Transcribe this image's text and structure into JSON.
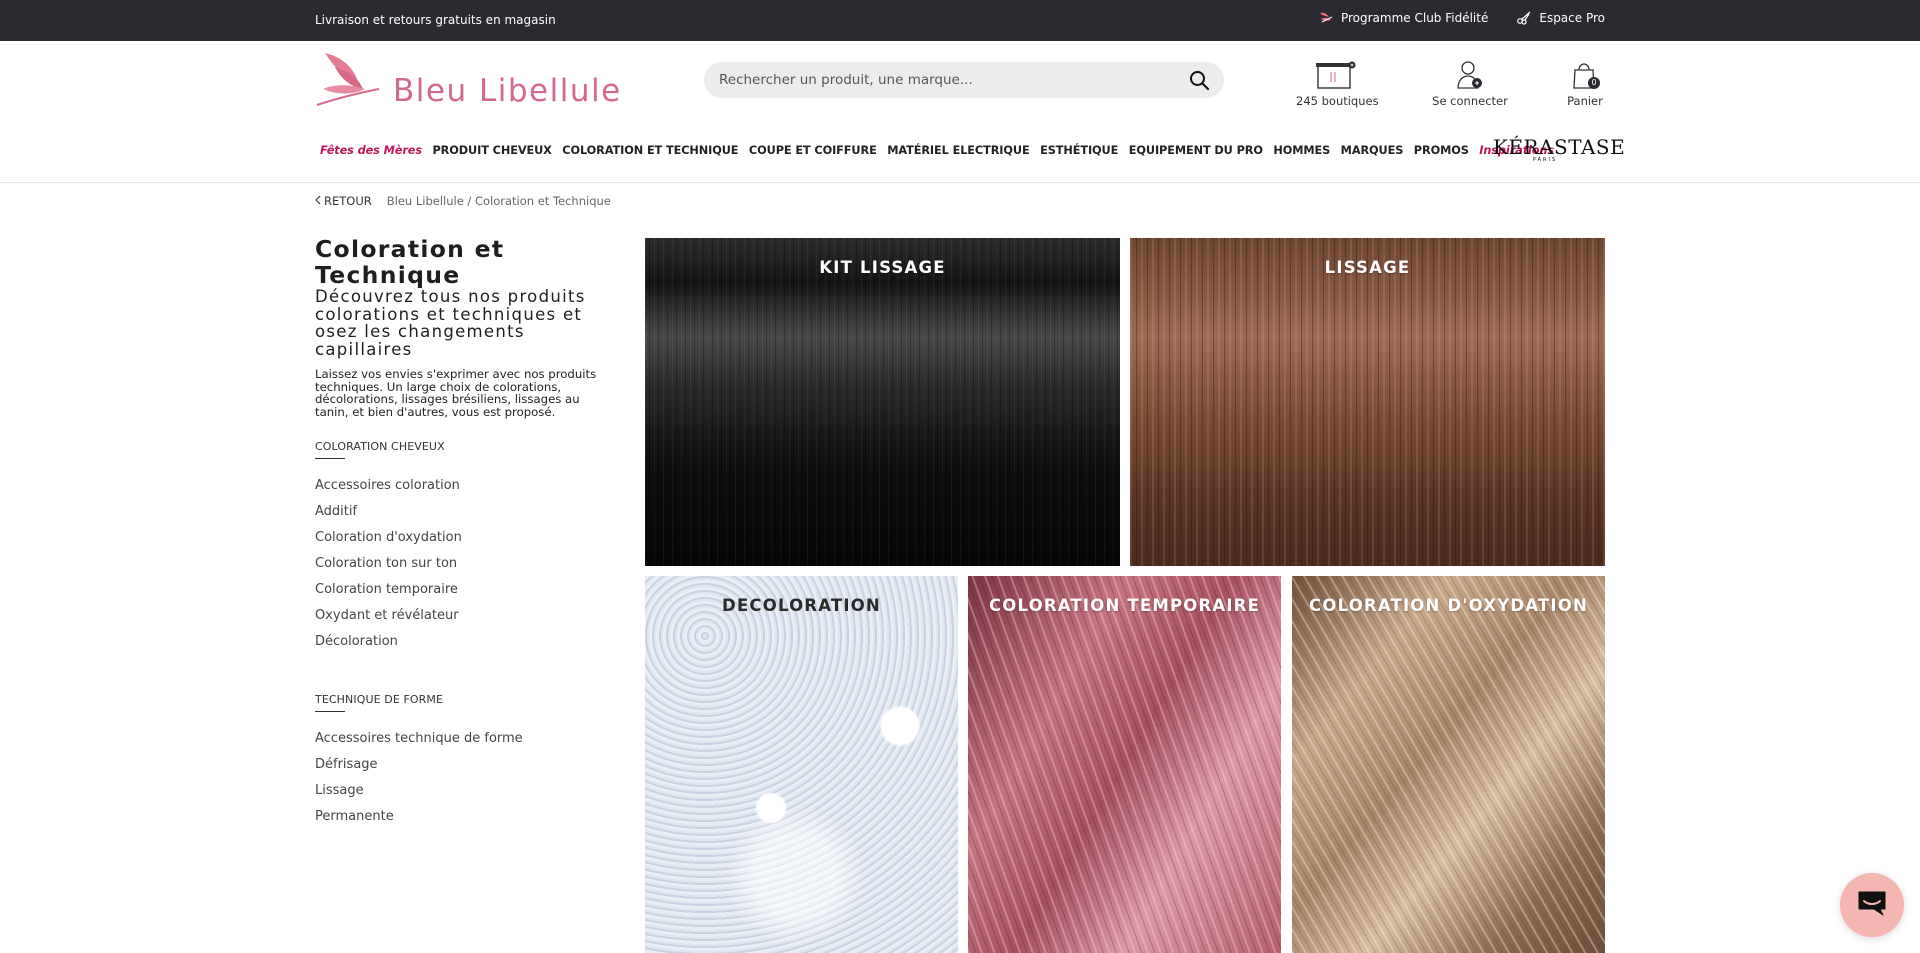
{
  "topbar": {
    "promo": "Livraison et retours gratuits en magasin",
    "club": "Programme Club Fidélité",
    "pro": "Espace Pro"
  },
  "header": {
    "brand": "Bleu Libellule",
    "search_placeholder": "Rechercher un produit, une marque...",
    "stores_label": "245 boutiques",
    "login_label": "Se connecter",
    "cart_label": "Panier",
    "cart_count": "0"
  },
  "nav": {
    "items": [
      "Fêtes des Mères",
      "PRODUIT CHEVEUX",
      "COLORATION ET TECHNIQUE",
      "COUPE ET COIFFURE",
      "MATÉRIEL ELECTRIQUE",
      "ESTHÉTIQUE",
      "EQUIPEMENT DU PRO",
      "HOMMES",
      "MARQUES",
      "PROMOS",
      "Inspirations"
    ],
    "kerastase": "KÉRASTASE",
    "kerastase_sub": "PARIS"
  },
  "breadcrumb": {
    "back": "RETOUR",
    "path": "Bleu Libellule / Coloration et Technique"
  },
  "category": {
    "title": "Coloration et Technique",
    "subtitle": "Découvrez tous nos produits colorations et techniques et osez les changements capillaires",
    "intro": "Laissez vos envies s'exprimer avec nos produits techniques. Un large choix de colorations, décolorations, lissages brésiliens, lissages au tanin, et bien d'autres, vous est proposé.",
    "section1_title": "COLORATION CHEVEUX",
    "section1_items": [
      "Accessoires coloration",
      "Additif",
      "Coloration d'oxydation",
      "Coloration ton sur ton",
      "Coloration temporaire",
      "Oxydant et révélateur",
      "Décoloration"
    ],
    "section2_title": "TECHNIQUE DE FORME",
    "section2_items": [
      "Accessoires technique de forme",
      "Défrisage",
      "Lissage",
      "Permanente"
    ]
  },
  "tiles": [
    "KIT LISSAGE",
    "LISSAGE",
    "DECOLORATION",
    "COLORATION TEMPORAIRE",
    "COLORATION D'OXYDATION"
  ],
  "colors": {
    "topbar_bg": "#2b2a30",
    "brand_pink": "#d36b88",
    "nav_accent": "#c2185b",
    "chat_bubble": "#f3b6b0"
  },
  "icons": {
    "club": "dragonfly-icon",
    "pro": "scissors-icon",
    "search": "search-icon",
    "stores": "store-icon",
    "login": "user-icon",
    "cart": "shopping-bag-icon",
    "back": "chevron-left-icon",
    "chat": "chat-icon"
  }
}
